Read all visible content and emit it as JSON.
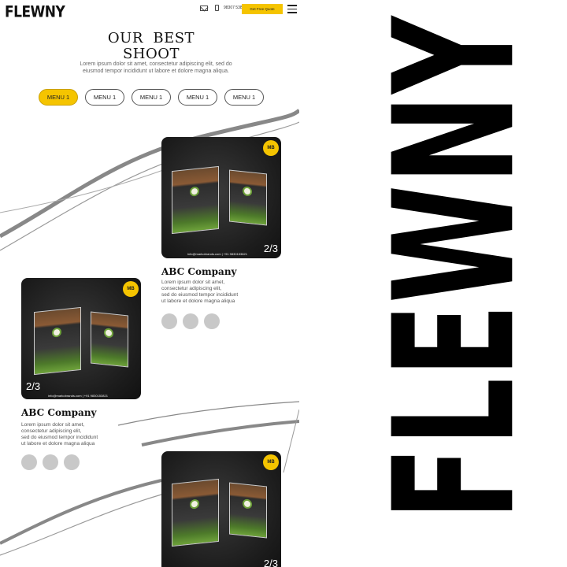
{
  "header": {
    "logo": "FLEWNY",
    "phone": "98307 53821",
    "quote_button": "Get Free Quote",
    "mail_icon": "mail-icon",
    "phone_icon": "phone-icon",
    "menu_icon": "hamburger-menu-icon"
  },
  "hero": {
    "title_line1": "OUR  BEST",
    "title_line2": "SHOOT",
    "subtitle": "Lorem ipsum dolor sit amet, consectetur adipiscing elit, sed do eiusmod tempor incididunt ut labore et dolore magna aliqua."
  },
  "tabs": [
    {
      "label": "MENU 1",
      "active": true
    },
    {
      "label": "MENU 1",
      "active": false
    },
    {
      "label": "MENU 1",
      "active": false
    },
    {
      "label": "MENU 1",
      "active": false
    },
    {
      "label": "MENU 1",
      "active": false
    }
  ],
  "items": [
    {
      "badge": "MB",
      "counter": "2/3",
      "footer": "info@markobrands.com | +91 9830153821",
      "company": "ABC Company",
      "description": "Lorem ipsum dolor sit amet,\n consectetur adipiscing elit,\nsed do eiusmod tempor incididunt\n ut labore et dolore magna aliqua"
    },
    {
      "badge": "MB",
      "counter": "2/3",
      "footer": "info@markobrands.com | +91 9830153821",
      "company": "ABC Company",
      "description": "Lorem ipsum dolor sit amet,\n consectetur adipiscing elit,\nsed do eiusmod tempor incididunt\n ut labore et dolore magna aliqua"
    },
    {
      "badge": "MB",
      "counter": "2/3"
    }
  ],
  "brand_vertical": "FLEWNY",
  "colors": {
    "accent": "#f5c400",
    "card_bg": "#1c1c1c",
    "dot": "#c8c8c8"
  }
}
